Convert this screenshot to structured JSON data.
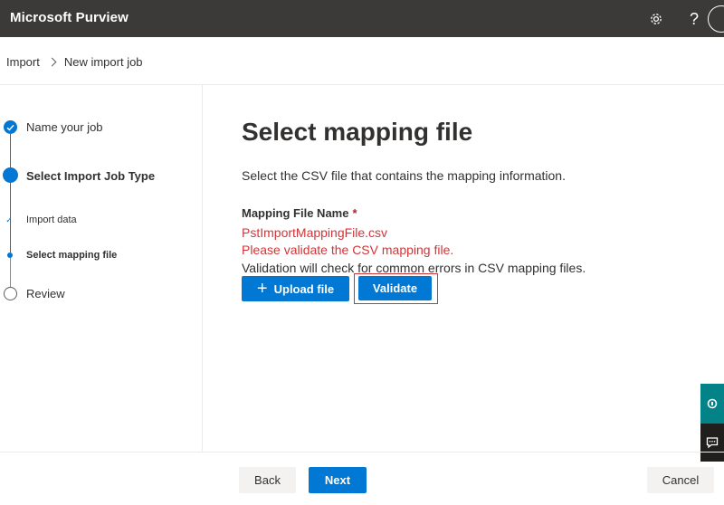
{
  "app": {
    "title": "Microsoft Purview"
  },
  "header": {
    "help_label": "?"
  },
  "breadcrumb": {
    "items": [
      "Import",
      "New import job"
    ]
  },
  "stepper": {
    "steps": [
      {
        "label": "Name your job",
        "state": "completed"
      },
      {
        "label": "Select Import Job Type",
        "state": "current"
      },
      {
        "label": "Import data",
        "state": "completed-sub"
      },
      {
        "label": "Select mapping file",
        "state": "current-sub"
      },
      {
        "label": "Review",
        "state": "not-started"
      }
    ]
  },
  "main": {
    "title": "Select mapping file",
    "description": "Select the CSV file that contains the mapping information.",
    "field_label": "Mapping File Name",
    "required_mark": "*",
    "file_name": "PstImportMappingFile.csv",
    "validation_warning": "Please validate the CSV mapping file.",
    "validation_hint": "Validation will check for common errors in CSV mapping files.",
    "upload_label": "Upload file",
    "validate_label": "Validate"
  },
  "footer": {
    "back_label": "Back",
    "next_label": "Next",
    "cancel_label": "Cancel"
  },
  "colors": {
    "accent": "#0078d4",
    "error": "#d13438",
    "topbar": "#3b3a39",
    "help_tab": "#038387"
  },
  "icons": {
    "settings": "gear-icon",
    "help": "question-icon",
    "upload": "plus-icon",
    "side_1": "support-icon",
    "side_2": "feedback-icon"
  }
}
